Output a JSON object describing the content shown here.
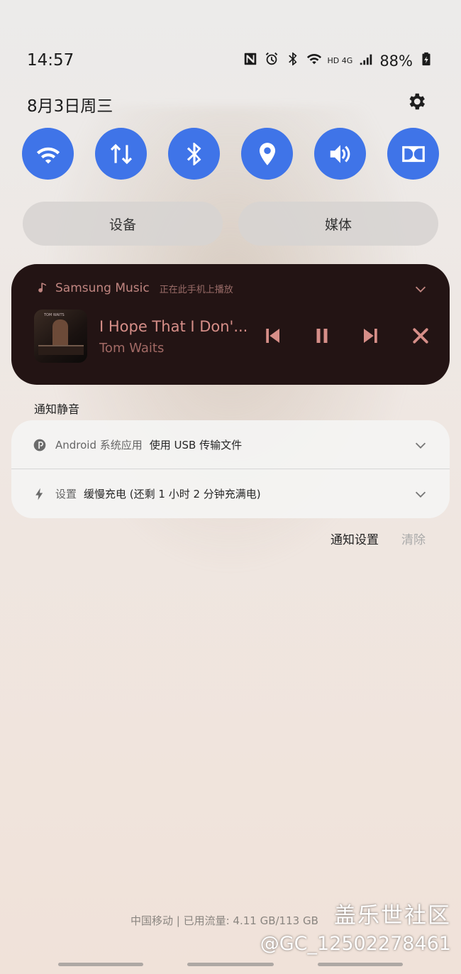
{
  "status_bar": {
    "time": "14:57",
    "battery": "88%",
    "network": "HD",
    "network_type": "4G",
    "icons": [
      "nfc-icon",
      "alarm-icon",
      "bluetooth-icon",
      "wifi-icon",
      "signal-icon",
      "battery-icon"
    ]
  },
  "header": {
    "date": "8月3日周三"
  },
  "quick_settings": [
    {
      "name": "wifi",
      "icon": "wifi-icon",
      "active": true
    },
    {
      "name": "mobile-data",
      "icon": "data-arrows-icon",
      "active": true
    },
    {
      "name": "bluetooth",
      "icon": "bluetooth-icon",
      "active": true
    },
    {
      "name": "location",
      "icon": "location-pin-icon",
      "active": true
    },
    {
      "name": "sound",
      "icon": "volume-icon",
      "active": true
    },
    {
      "name": "dolby",
      "icon": "dolby-icon",
      "active": true
    }
  ],
  "pills": {
    "devices": "设备",
    "media": "媒体"
  },
  "media": {
    "app": "Samsung Music",
    "subtitle": "正在此手机上播放",
    "title": "I Hope That I Don'...",
    "artist": "Tom Waits",
    "album_label": "TOM WAITS"
  },
  "section": {
    "silent_label": "通知静音"
  },
  "notifications": [
    {
      "app": "Android 系统应用",
      "text": "使用 USB 传输文件"
    },
    {
      "app": "设置",
      "text": "缓慢充电 (还剩 1 小时 2 分钟充满电)"
    }
  ],
  "actions": {
    "settings": "通知设置",
    "clear": "清除"
  },
  "footer": {
    "carrier": "中国移动 | 已用流量: 4.11 GB/113 GB",
    "watermark_title": "盖乐世社区",
    "watermark_user": "@GC_12502278461"
  },
  "colors": {
    "accent": "#3f74e8",
    "media_bg": "#231414",
    "media_text": "#d68e88"
  }
}
